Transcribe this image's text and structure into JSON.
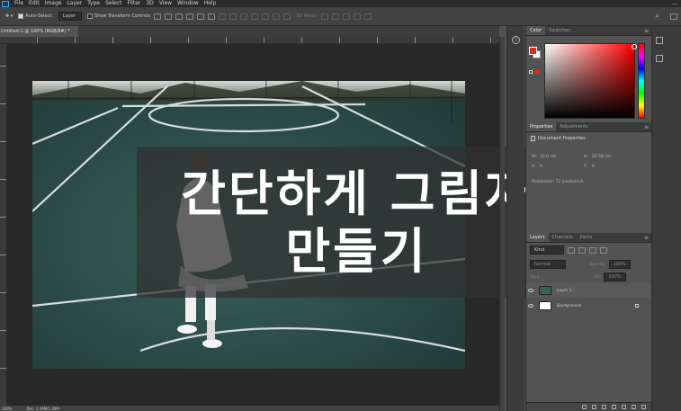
{
  "menubar": {
    "items": [
      "File",
      "Edit",
      "Image",
      "Layer",
      "Type",
      "Select",
      "Filter",
      "3D",
      "View",
      "Window",
      "Help"
    ]
  },
  "options": {
    "auto_select_label": "Auto-Select:",
    "auto_select_value": "Layer",
    "transform_label": "Show Transform Controls",
    "mode_3d_label": "3D Mode:"
  },
  "document": {
    "tab_title": "Untitled-1 @ 100% (RGB/8#) *",
    "zoom": "100%",
    "doc_info": "Doc: 1.39M/1.39M"
  },
  "canvas": {
    "title_line1": "간단하게 그림자",
    "title_line2": "만들기"
  },
  "color_panel": {
    "tabs": [
      "Color",
      "Swatches"
    ],
    "foreground": "#e5281a",
    "background": "#ffffff"
  },
  "properties_panel": {
    "tabs": [
      "Properties",
      "Adjustments"
    ],
    "section": "Document Properties",
    "w_label": "W:",
    "w_value": "33.0 cm",
    "h_label": "H:",
    "h_value": "22.58 cm",
    "x_label": "X:",
    "x_value": "0",
    "y_label": "Y:",
    "y_value": "0",
    "resolution": "Resolution: 72 pixels/inch"
  },
  "layers_panel": {
    "tabs": [
      "Layers",
      "Channels",
      "Paths"
    ],
    "filter_label": "Kind",
    "blend_mode": "Normal",
    "opacity_label": "Opacity:",
    "opacity_value": "100%",
    "lock_label": "Lock:",
    "fill_label": "Fill:",
    "fill_value": "100%",
    "layers": [
      {
        "name": "Layer 1"
      },
      {
        "name": "Background"
      }
    ]
  }
}
